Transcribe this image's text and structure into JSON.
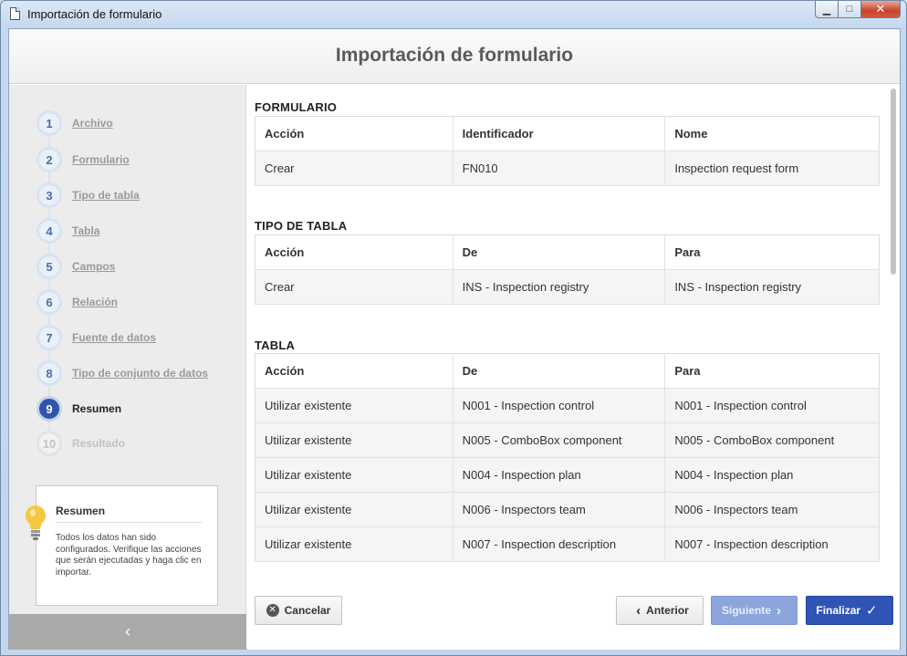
{
  "window": {
    "title": "Importación de formulario"
  },
  "header": {
    "title": "Importación de formulario"
  },
  "steps": [
    {
      "number": "1",
      "label": "Archivo"
    },
    {
      "number": "2",
      "label": "Formulario"
    },
    {
      "number": "3",
      "label": "Tipo de tabla"
    },
    {
      "number": "4",
      "label": "Tabla"
    },
    {
      "number": "5",
      "label": "Campos"
    },
    {
      "number": "6",
      "label": "Relación"
    },
    {
      "number": "7",
      "label": "Fuente de datos"
    },
    {
      "number": "8",
      "label": "Tipo de conjunto de datos"
    },
    {
      "number": "9",
      "label": "Resumen"
    },
    {
      "number": "10",
      "label": "Resultado"
    }
  ],
  "active_step": "9",
  "hint": {
    "title": "Resumen",
    "text": "Todos los datos han sido configurados. Verifique las acciones que serán ejecutadas y haga clic en importar."
  },
  "sections": {
    "formulario": {
      "title": "FORMULARIO",
      "headers": [
        "Acción",
        "Identificador",
        "Nome"
      ],
      "rows": [
        [
          "Crear",
          "FN010",
          "Inspection request form"
        ]
      ]
    },
    "tipo_tabla": {
      "title": "TIPO DE TABLA",
      "headers": [
        "Acción",
        "De",
        "Para"
      ],
      "rows": [
        [
          "Crear",
          "INS - Inspection registry",
          "INS - Inspection registry"
        ]
      ]
    },
    "tabla": {
      "title": "TABLA",
      "headers": [
        "Acción",
        "De",
        "Para"
      ],
      "rows": [
        [
          "Utilizar existente",
          "N001 - Inspection control",
          "N001 - Inspection control"
        ],
        [
          "Utilizar existente",
          "N005 - ComboBox component",
          "N005 - ComboBox component"
        ],
        [
          "Utilizar existente",
          "N004 - Inspection plan",
          "N004 - Inspection plan"
        ],
        [
          "Utilizar existente",
          "N006 - Inspectors team",
          "N006 - Inspectors team"
        ],
        [
          "Utilizar existente",
          "N007 - Inspection description",
          "N007 - Inspection description"
        ]
      ]
    }
  },
  "buttons": {
    "cancel": "Cancelar",
    "previous": "Anterior",
    "next": "Siguiente",
    "finish": "Finalizar"
  }
}
